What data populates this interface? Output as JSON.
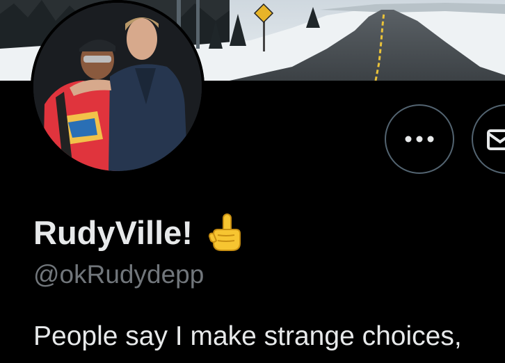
{
  "profile": {
    "display_name": "RudyVille!",
    "name_emoji": "☝",
    "handle": "@okRudydepp",
    "bio": "People say I make strange choices,"
  },
  "banner": {
    "description_icon": "winter-road-banner"
  },
  "avatar": {
    "description_icon": "profile-photo-icon"
  },
  "actions": {
    "more_label": "•••",
    "more_icon": "more-horizontal-icon",
    "message_icon": "envelope-icon"
  },
  "colors": {
    "background": "#000000",
    "text_primary": "#e7e9ea",
    "text_secondary": "#71767b",
    "button_border": "#536471",
    "emoji_yellow": "#f7c531"
  }
}
